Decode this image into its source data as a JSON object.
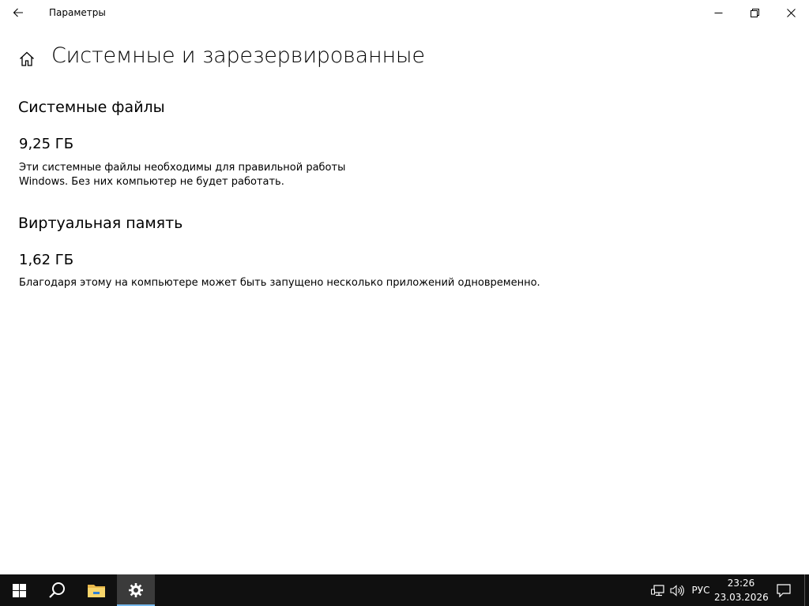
{
  "window": {
    "title": "Параметры",
    "back_icon": "arrow-left-icon",
    "controls": [
      "minimize-icon",
      "restore-icon",
      "close-icon"
    ]
  },
  "page": {
    "home_icon": "home-icon",
    "title": "Системные и зарезервированные"
  },
  "sections": [
    {
      "heading": "Системные файлы",
      "size": "9,25 ГБ",
      "description_line1": "Эти системные файлы необходимы для правильной работы",
      "description_line2": "Windows. Без них компьютер не будет работать."
    },
    {
      "heading": "Виртуальная память",
      "size": "1,62 ГБ",
      "description": "Благодаря этому на компьютере может быть запущено несколько приложений одновременно."
    }
  ],
  "taskbar": {
    "buttons": [
      "windows-start-icon",
      "search-icon",
      "file-explorer-icon",
      "settings-gear-icon"
    ],
    "active": "settings-gear-icon",
    "tray_icons": [
      "network-icon",
      "volume-icon"
    ],
    "language": "РУС",
    "time": "23:26",
    "date": "23.03.2026",
    "notification_icon": "action-center-icon",
    "accent_color": "#76b9ed",
    "background_color": "#101010"
  }
}
